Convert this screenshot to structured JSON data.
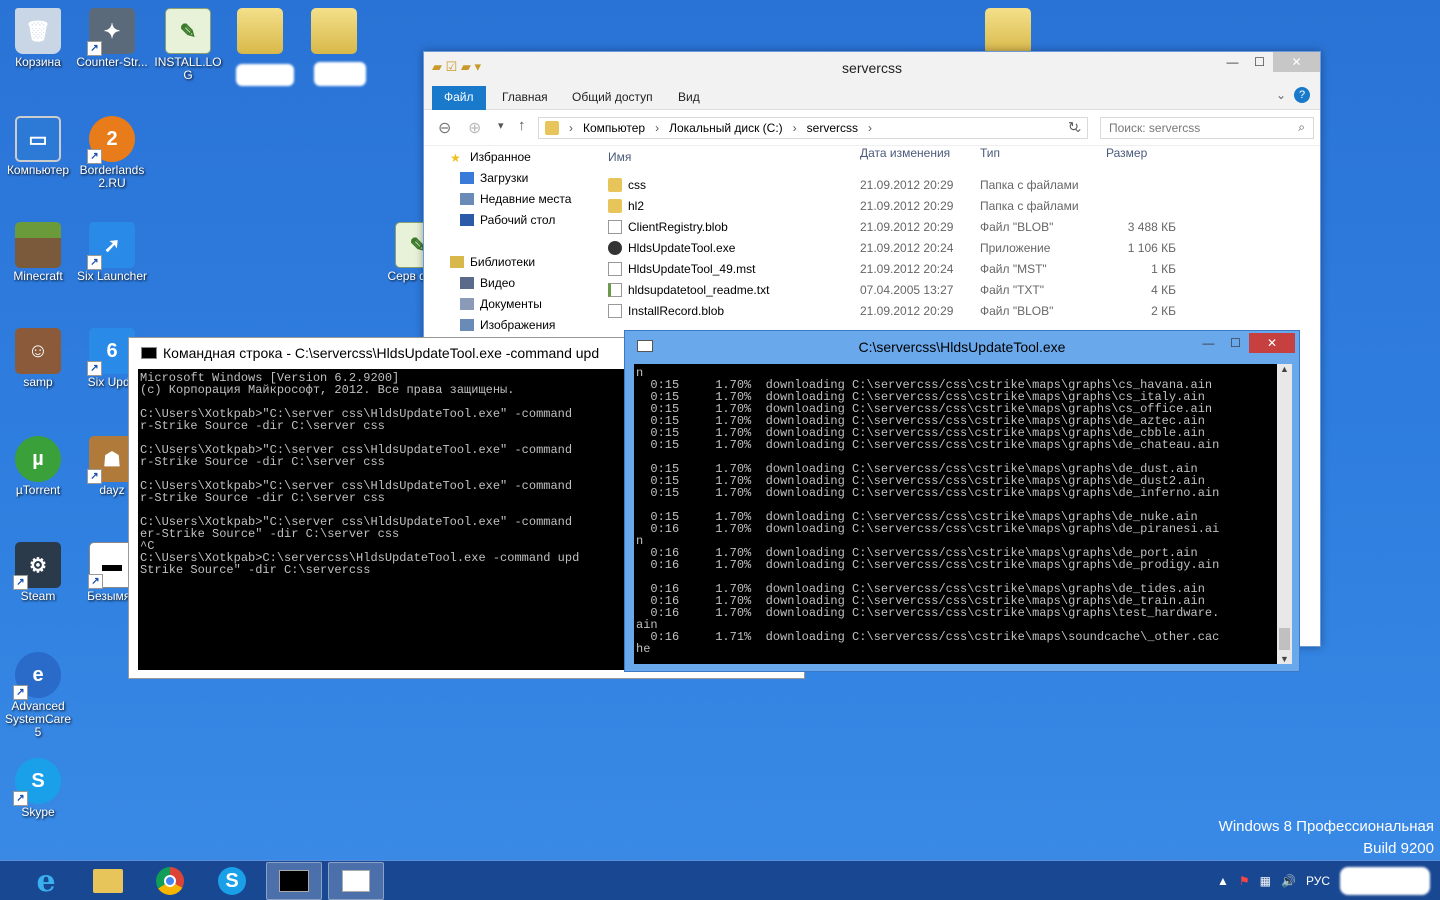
{
  "desktop": {
    "icons": [
      {
        "label": "Корзина",
        "color": "#c9d6e6"
      },
      {
        "label": "Counter-Str...",
        "color": "#5a6a7a"
      },
      {
        "label": "INSTALL.LOG",
        "color": "#e8f2d8"
      },
      {
        "label": "Компьютер",
        "color": "#2c7ad6"
      },
      {
        "label": "Borderlands 2.RU",
        "color": "#e87b1a"
      },
      {
        "label": "Minecraft",
        "color": "#6a9a3a"
      },
      {
        "label": "Six Launcher",
        "color": "#2a8ae8"
      },
      {
        "label": "samp",
        "color": "#8a5a3a"
      },
      {
        "label": "Six Upda",
        "color": "#2a8ae8"
      },
      {
        "label": "µTorrent",
        "color": "#3aa03a"
      },
      {
        "label": "dayz",
        "color": "#b07a3a"
      },
      {
        "label": "Steam",
        "color": "#2a3a4a"
      },
      {
        "label": "Безымян",
        "color": "#ffffff"
      },
      {
        "label": "Advanced SystemCare 5",
        "color": "#2a6ac8"
      },
      {
        "label": "Skype",
        "color": "#1aa0e8"
      },
      {
        "label": "Серв day-z",
        "color": "#e8f2d8"
      }
    ]
  },
  "watermark": {
    "line1": "Windows 8 Профессиональная",
    "line2": "Build 9200"
  },
  "taskbar": {
    "tray_lang": "РУС"
  },
  "explorer": {
    "title": "servercss",
    "ribbon_tabs": [
      "Файл",
      "Главная",
      "Общий доступ",
      "Вид"
    ],
    "breadcrumb": [
      "Компьютер",
      "Локальный диск (C:)",
      "servercss"
    ],
    "search_placeholder": "Поиск: servercss",
    "nav": [
      {
        "label": "Избранное",
        "color": "#f0c020",
        "indent": 0
      },
      {
        "label": "Загрузки",
        "color": "#3a7ad8",
        "indent": 1
      },
      {
        "label": "Недавние места",
        "color": "#6a8ab8",
        "indent": 1
      },
      {
        "label": "Рабочий стол",
        "color": "#2a5aa8",
        "indent": 1
      },
      {
        "label": "",
        "color": "",
        "indent": 0
      },
      {
        "label": "Библиотеки",
        "color": "#d8b84a",
        "indent": 0
      },
      {
        "label": "Видео",
        "color": "#5a6a8a",
        "indent": 1
      },
      {
        "label": "Документы",
        "color": "#8a9ab8",
        "indent": 1
      },
      {
        "label": "Изображения",
        "color": "#6a8ab8",
        "indent": 1
      }
    ],
    "columns": {
      "name": "Имя",
      "date": "Дата изменения",
      "type": "Тип",
      "size": "Размер"
    },
    "files": [
      {
        "name": "css",
        "date": "21.09.2012 20:29",
        "type": "Папка с файлами",
        "size": "",
        "kind": "folder"
      },
      {
        "name": "hl2",
        "date": "21.09.2012 20:29",
        "type": "Папка с файлами",
        "size": "",
        "kind": "folder"
      },
      {
        "name": "ClientRegistry.blob",
        "date": "21.09.2012 20:29",
        "type": "Файл \"BLOB\"",
        "size": "3 488 КБ",
        "kind": "doc"
      },
      {
        "name": "HldsUpdateTool.exe",
        "date": "21.09.2012 20:24",
        "type": "Приложение",
        "size": "1 106 КБ",
        "kind": "exe"
      },
      {
        "name": "HldsUpdateTool_49.mst",
        "date": "21.09.2012 20:24",
        "type": "Файл \"MST\"",
        "size": "1 КБ",
        "kind": "doc"
      },
      {
        "name": "hldsupdatetool_readme.txt",
        "date": "07.04.2005 13:27",
        "type": "Файл \"TXT\"",
        "size": "4 КБ",
        "kind": "txt"
      },
      {
        "name": "InstallRecord.blob",
        "date": "21.09.2012 20:29",
        "type": "Файл \"BLOB\"",
        "size": "2 КБ",
        "kind": "doc"
      }
    ]
  },
  "cmd1": {
    "title": "Командная строка - C:\\servercss\\HldsUpdateTool.exe  -command upd",
    "text": "Microsoft Windows [Version 6.2.9200]\n(c) Корпорация Майкрософт, 2012. Все права защищены.\n\nC:\\Users\\Xotkpab>\"C:\\server css\\HldsUpdateTool.exe\" -command\nr-Strike Source -dir C:\\server css\n\nC:\\Users\\Xotkpab>\"C:\\server css\\HldsUpdateTool.exe\" -command\nr-Strike Source -dir C:\\server css\n\nC:\\Users\\Xotkpab>\"C:\\server css\\HldsUpdateTool.exe\" -command\nr-Strike Source -dir C:\\server css\n\nC:\\Users\\Xotkpab>\"C:\\server css\\HldsUpdateTool.exe\" -command\ner-Strike Source\" -dir C:\\server css\n^C\nC:\\Users\\Xotkpab>C:\\servercss\\HldsUpdateTool.exe -command upd\nStrike Source\" -dir C:\\servercss"
  },
  "cmd2": {
    "title": "C:\\servercss\\HldsUpdateTool.exe",
    "text": "n\n  0:15     1.70%  downloading C:\\servercss/css\\cstrike\\maps\\graphs\\cs_havana.ain\n  0:15     1.70%  downloading C:\\servercss/css\\cstrike\\maps\\graphs\\cs_italy.ain\n  0:15     1.70%  downloading C:\\servercss/css\\cstrike\\maps\\graphs\\cs_office.ain\n  0:15     1.70%  downloading C:\\servercss/css\\cstrike\\maps\\graphs\\de_aztec.ain\n  0:15     1.70%  downloading C:\\servercss/css\\cstrike\\maps\\graphs\\de_cbble.ain\n  0:15     1.70%  downloading C:\\servercss/css\\cstrike\\maps\\graphs\\de_chateau.ain\n\n  0:15     1.70%  downloading C:\\servercss/css\\cstrike\\maps\\graphs\\de_dust.ain\n  0:15     1.70%  downloading C:\\servercss/css\\cstrike\\maps\\graphs\\de_dust2.ain\n  0:15     1.70%  downloading C:\\servercss/css\\cstrike\\maps\\graphs\\de_inferno.ain\n\n  0:15     1.70%  downloading C:\\servercss/css\\cstrike\\maps\\graphs\\de_nuke.ain\n  0:16     1.70%  downloading C:\\servercss/css\\cstrike\\maps\\graphs\\de_piranesi.ai\nn\n  0:16     1.70%  downloading C:\\servercss/css\\cstrike\\maps\\graphs\\de_port.ain\n  0:16     1.70%  downloading C:\\servercss/css\\cstrike\\maps\\graphs\\de_prodigy.ain\n\n  0:16     1.70%  downloading C:\\servercss/css\\cstrike\\maps\\graphs\\de_tides.ain\n  0:16     1.70%  downloading C:\\servercss/css\\cstrike\\maps\\graphs\\de_train.ain\n  0:16     1.70%  downloading C:\\servercss/css\\cstrike\\maps\\graphs\\test_hardware.\nain\n  0:16     1.71%  downloading C:\\servercss/css\\cstrike\\maps\\soundcache\\_other.cac\nhe"
  }
}
